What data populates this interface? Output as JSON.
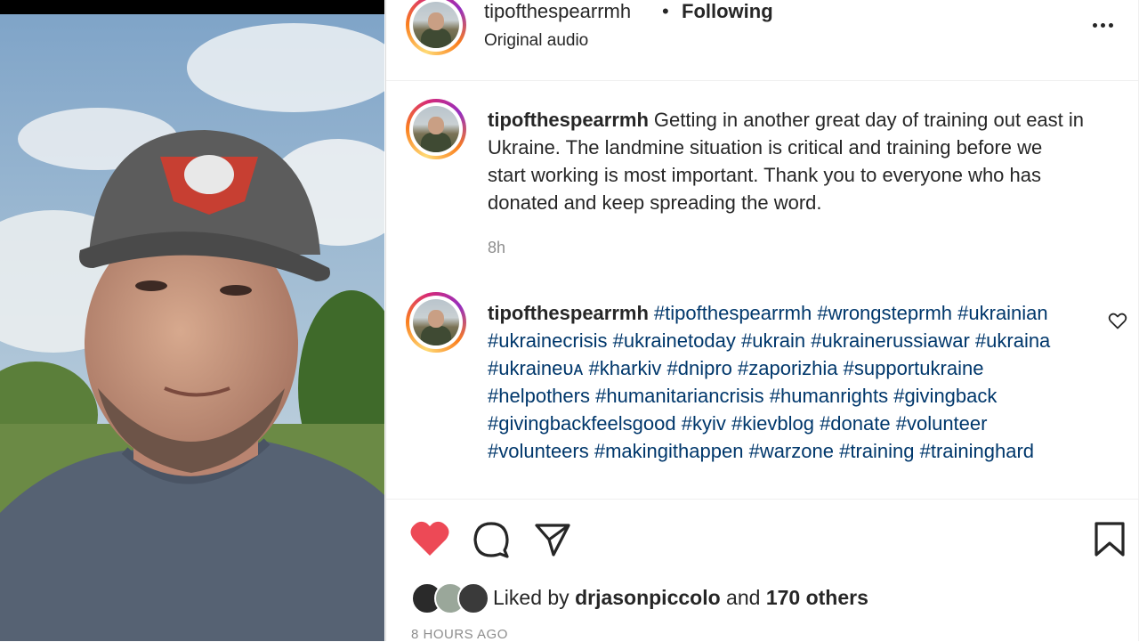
{
  "post": {
    "username": "tipofthespearrmh",
    "separator": "•",
    "follow_status": "Following",
    "audio": "Original audio"
  },
  "caption": {
    "username": "tipofthespearrmh",
    "text": "Getting in another great day of training out east in Ukraine. The landmine situation is critical and training before we start working is most important. Thank you to everyone who has donated and keep spreading the word.",
    "time": "8h"
  },
  "comment": {
    "username": "tipofthespearrmh",
    "hashtags": [
      "#tipofthespearrmh",
      "#wrongsteprmh",
      "#ukrainian",
      "#ukrainecrisis",
      "#ukrainetoday",
      "#ukrain",
      "#ukrainerussiawar",
      "#ukraina",
      "#ukraineᴜᴀ",
      "#kharkiv",
      "#dnipro",
      "#zaporizhia",
      "#supportukraine",
      "#helpothers",
      "#humanitariancrisis",
      "#humanrights",
      "#givingback",
      "#givingbackfeelsgood",
      "#kyiv",
      "#kievblog",
      "#donate",
      "#volunteer",
      "#volunteers",
      "#makingithappen",
      "#warzone",
      "#training",
      "#traininghard"
    ]
  },
  "likes": {
    "prefix": "Liked by",
    "user": "drjasonpiccolo",
    "joiner": "and",
    "others": "170 others"
  },
  "timestamp": "8 HOURS AGO",
  "icons": {
    "like": "heart-filled-icon",
    "comment": "comment-bubble-icon",
    "share": "paper-plane-icon",
    "save": "bookmark-icon",
    "more": "more-dots-icon",
    "comment_like": "heart-outline-icon"
  },
  "colors": {
    "like_red": "#ed4956",
    "hashtag_blue": "#00376b",
    "muted": "#8e8e8e",
    "text": "#262626"
  }
}
